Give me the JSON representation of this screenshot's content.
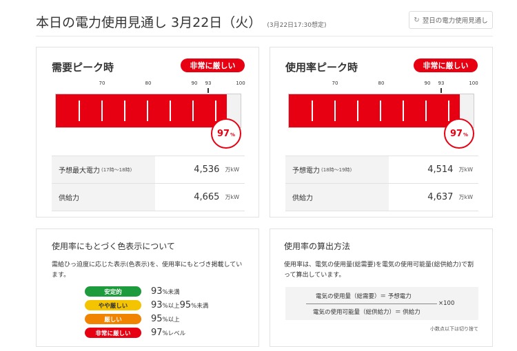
{
  "header": {
    "title": "本日の電力使用見通し  3月22日（火）",
    "subtitle": "(3月22日17:30想定)",
    "next_day_button": "翌日の電力使用見通し"
  },
  "demand_peak": {
    "title": "需要ピーク時",
    "badge": "非常に厳しい",
    "tick_labels": [
      "70",
      "80",
      "90",
      "93",
      "100"
    ],
    "usage_percent": 97,
    "percent_value": "97",
    "percent_unit": "%",
    "rows": [
      {
        "label": "予想最大電力",
        "note": "(17時〜18時)",
        "value": "4,536",
        "unit": "万kW"
      },
      {
        "label": "供給力",
        "note": "",
        "value": "4,665",
        "unit": "万kW"
      }
    ]
  },
  "usage_rate_peak": {
    "title": "使用率ピーク時",
    "badge": "非常に厳しい",
    "tick_labels": [
      "70",
      "80",
      "90",
      "93",
      "100"
    ],
    "usage_percent": 97,
    "percent_value": "97",
    "percent_unit": "%",
    "rows": [
      {
        "label": "予想電力",
        "note": "(18時〜19時)",
        "value": "4,514",
        "unit": "万kW"
      },
      {
        "label": "供給力",
        "note": "",
        "value": "4,637",
        "unit": "万kW"
      }
    ]
  },
  "color_legend": {
    "title": "使用率にもとづく色表示について",
    "description": "需給ひっ迫度に応じた表示(色表示)を、使用率にもとづき掲載しています。",
    "items": [
      {
        "label": "安定的",
        "value": "93",
        "suffix": "%未満",
        "value2": "",
        "suffix2": "",
        "color": "#1e9b3c",
        "text_color": "#ffffff"
      },
      {
        "label": "やや厳しい",
        "value": "93",
        "suffix": "%以上",
        "value2": "95",
        "suffix2": "%未満",
        "color": "#f5c400",
        "text_color": "#333333"
      },
      {
        "label": "厳しい",
        "value": "95",
        "suffix": "%以上",
        "value2": "",
        "suffix2": "",
        "color": "#f08300",
        "text_color": "#ffffff"
      },
      {
        "label": "非常に厳しい",
        "value": "97",
        "suffix": "%レベル",
        "value2": "",
        "suffix2": "",
        "color": "#e60012",
        "text_color": "#ffffff"
      }
    ]
  },
  "calc_method": {
    "title": "使用率の算出方法",
    "description": "使用率は、電気の使用量(総需要)を電気の使用可能量(総供給力)で割って算出しています。",
    "numerator": "電気の使用量（総需要）＝ 予想電力",
    "denominator": "電気の使用可能量（総供給力）＝ 供給力",
    "multiplier": "×100",
    "note": "小数点以下は切り捨て"
  },
  "colors": {
    "accent_red": "#e60012"
  }
}
